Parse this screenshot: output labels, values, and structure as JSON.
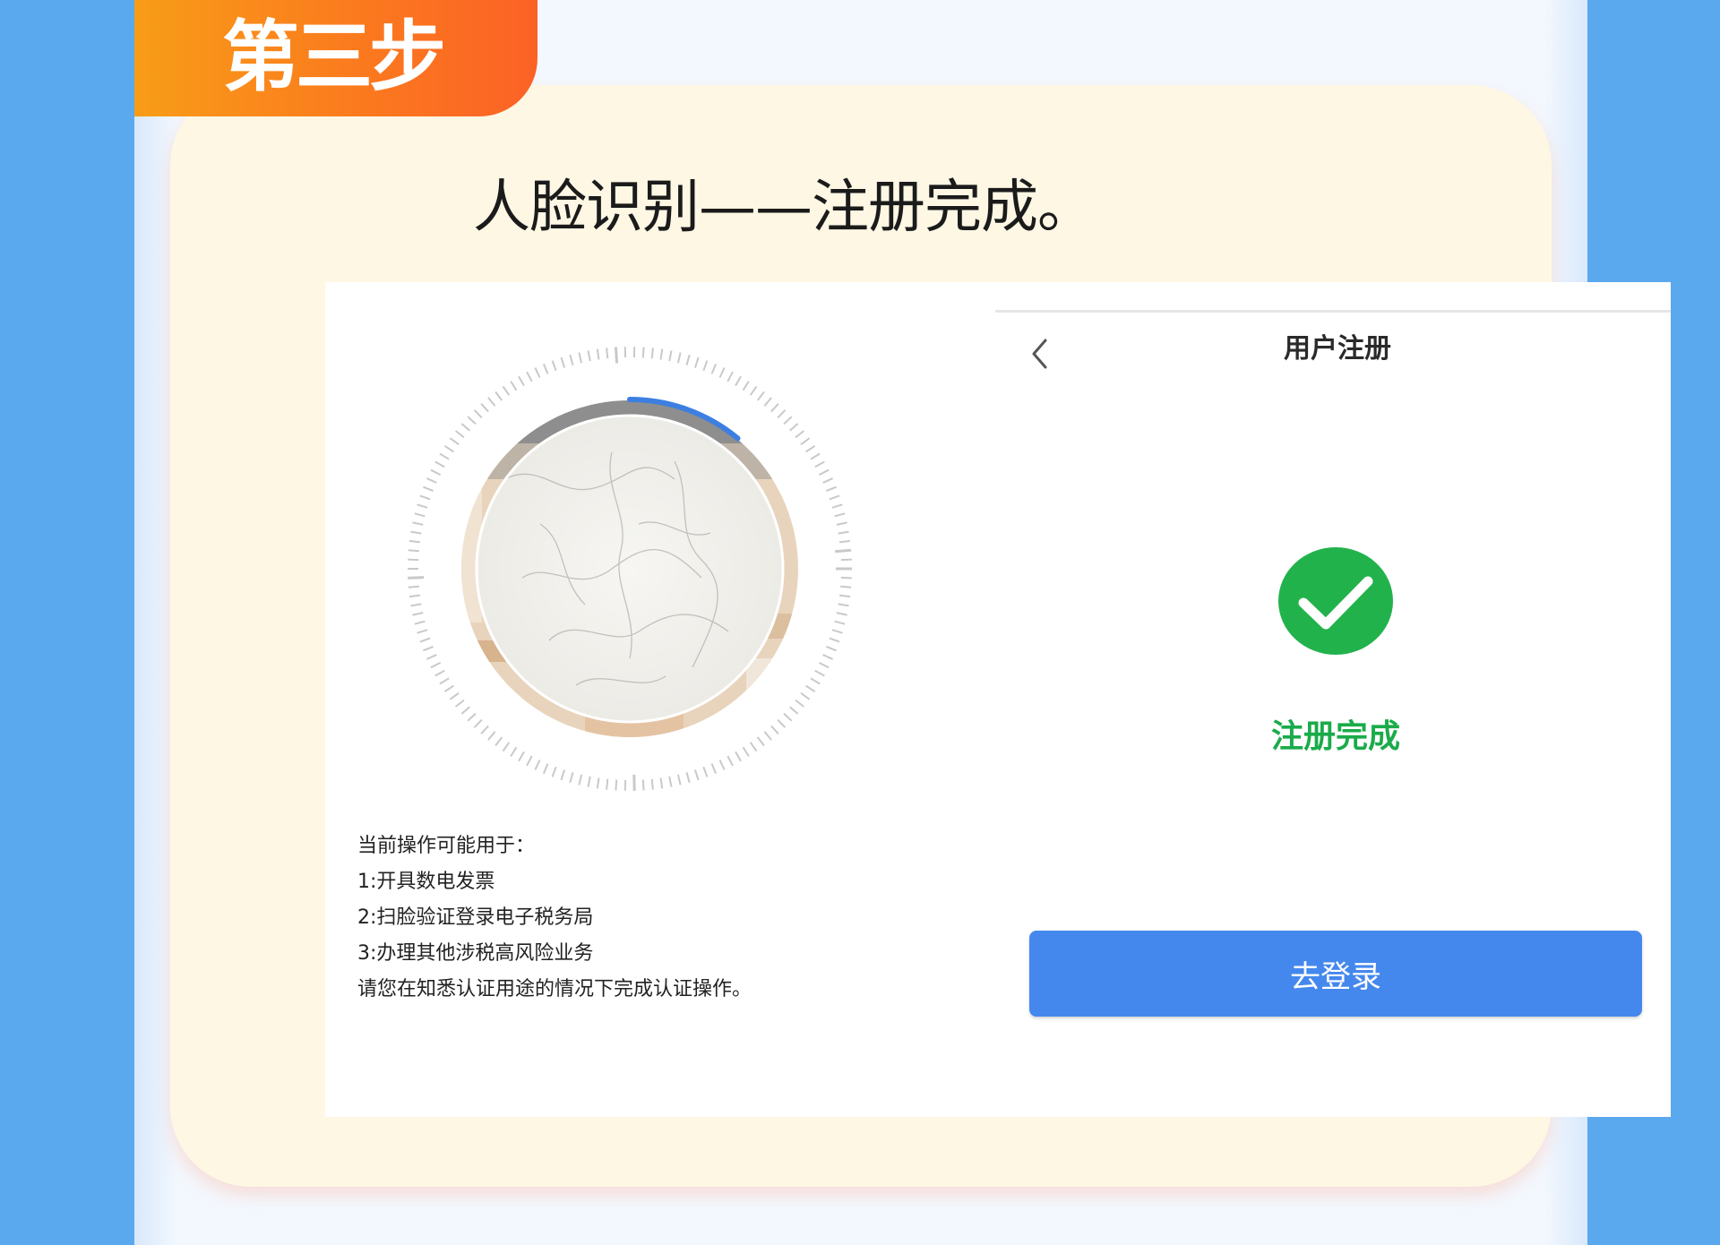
{
  "step": {
    "label": "第三步"
  },
  "heading": "人脸识别——注册完成。",
  "face_scan": {
    "progress_fraction": 0.11,
    "usage_notes": [
      "当前操作可能用于：",
      "1:开具数电发票",
      "2:扫脸验证登录电子税务局",
      "3:办理其他涉税高风险业务",
      "请您在知悉认证用途的情况下完成认证操作。"
    ]
  },
  "register": {
    "back_icon": "chevron-left-icon",
    "title": "用户注册",
    "status_icon": "check-circle-icon",
    "status_text": "注册完成",
    "login_button": "去登录"
  },
  "colors": {
    "background": "#5aa8ee",
    "card": "#fdf7e4",
    "badge_start": "#f89d18",
    "badge_end": "#fb6226",
    "success": "#22b24c",
    "primary_button": "#4488ee",
    "scan_progress": "#3d7fe0"
  }
}
